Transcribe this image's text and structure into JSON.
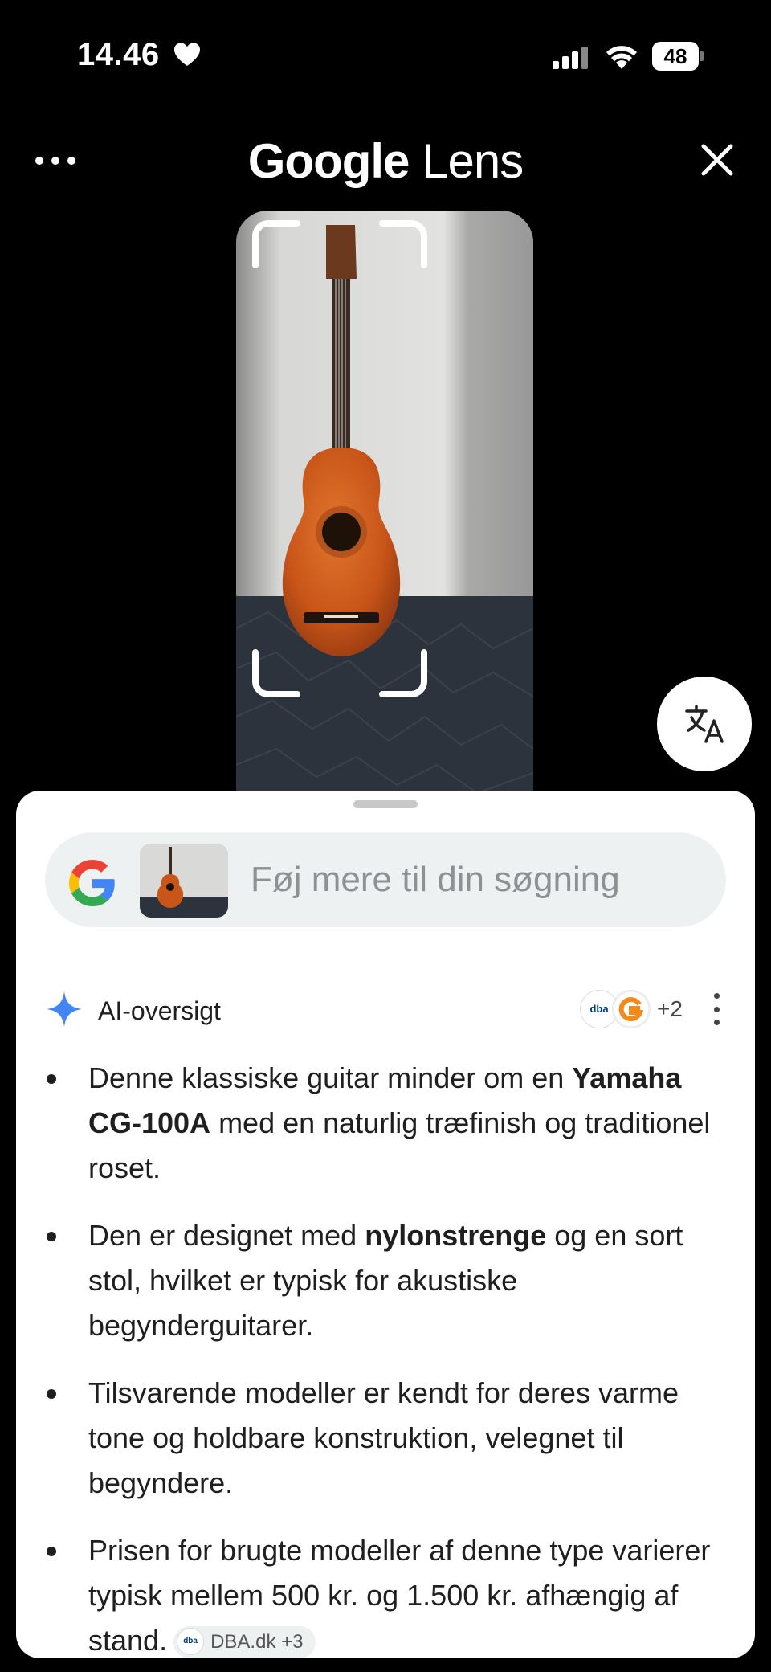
{
  "status_bar": {
    "time": "14.46",
    "battery": "48"
  },
  "header": {
    "title_google": "Google",
    "title_lens": "Lens"
  },
  "search": {
    "placeholder": "Føj mere til din søgning"
  },
  "ai_overview": {
    "label": "AI-oversigt",
    "sources_source_dba": "dba",
    "sources_more": "+2",
    "bullets": [
      {
        "p1": "Denne klassiske guitar minder om en ",
        "b1": "Yamaha CG-100A",
        "p2": " med en naturlig træfinish og traditionel roset."
      },
      {
        "p1": "Den er designet med ",
        "b1": "nylonstrenge",
        "p2": " og en sort stol, hvilket er typisk for akustiske begynderguitarer."
      },
      {
        "p1": "Tilsvarende modeller er kendt for deres varme tone og holdbare konstruktion, velegnet til begyndere."
      },
      {
        "p1": "Prisen for brugte modeller af denne type varierer typisk mellem 500 kr. og 1.500 kr. afhængig af stand.",
        "chip_icon": "dba",
        "chip": "DBA.dk +3"
      }
    ]
  },
  "colors": {
    "accent_blue": "#4285F4",
    "background": "#000000",
    "sheet": "#ffffff"
  },
  "icons": [
    "heart-icon",
    "signal-icon",
    "wifi-icon",
    "more-icon",
    "close-icon",
    "translate-icon",
    "google-g-icon",
    "sparkle-icon",
    "kebab-icon"
  ]
}
